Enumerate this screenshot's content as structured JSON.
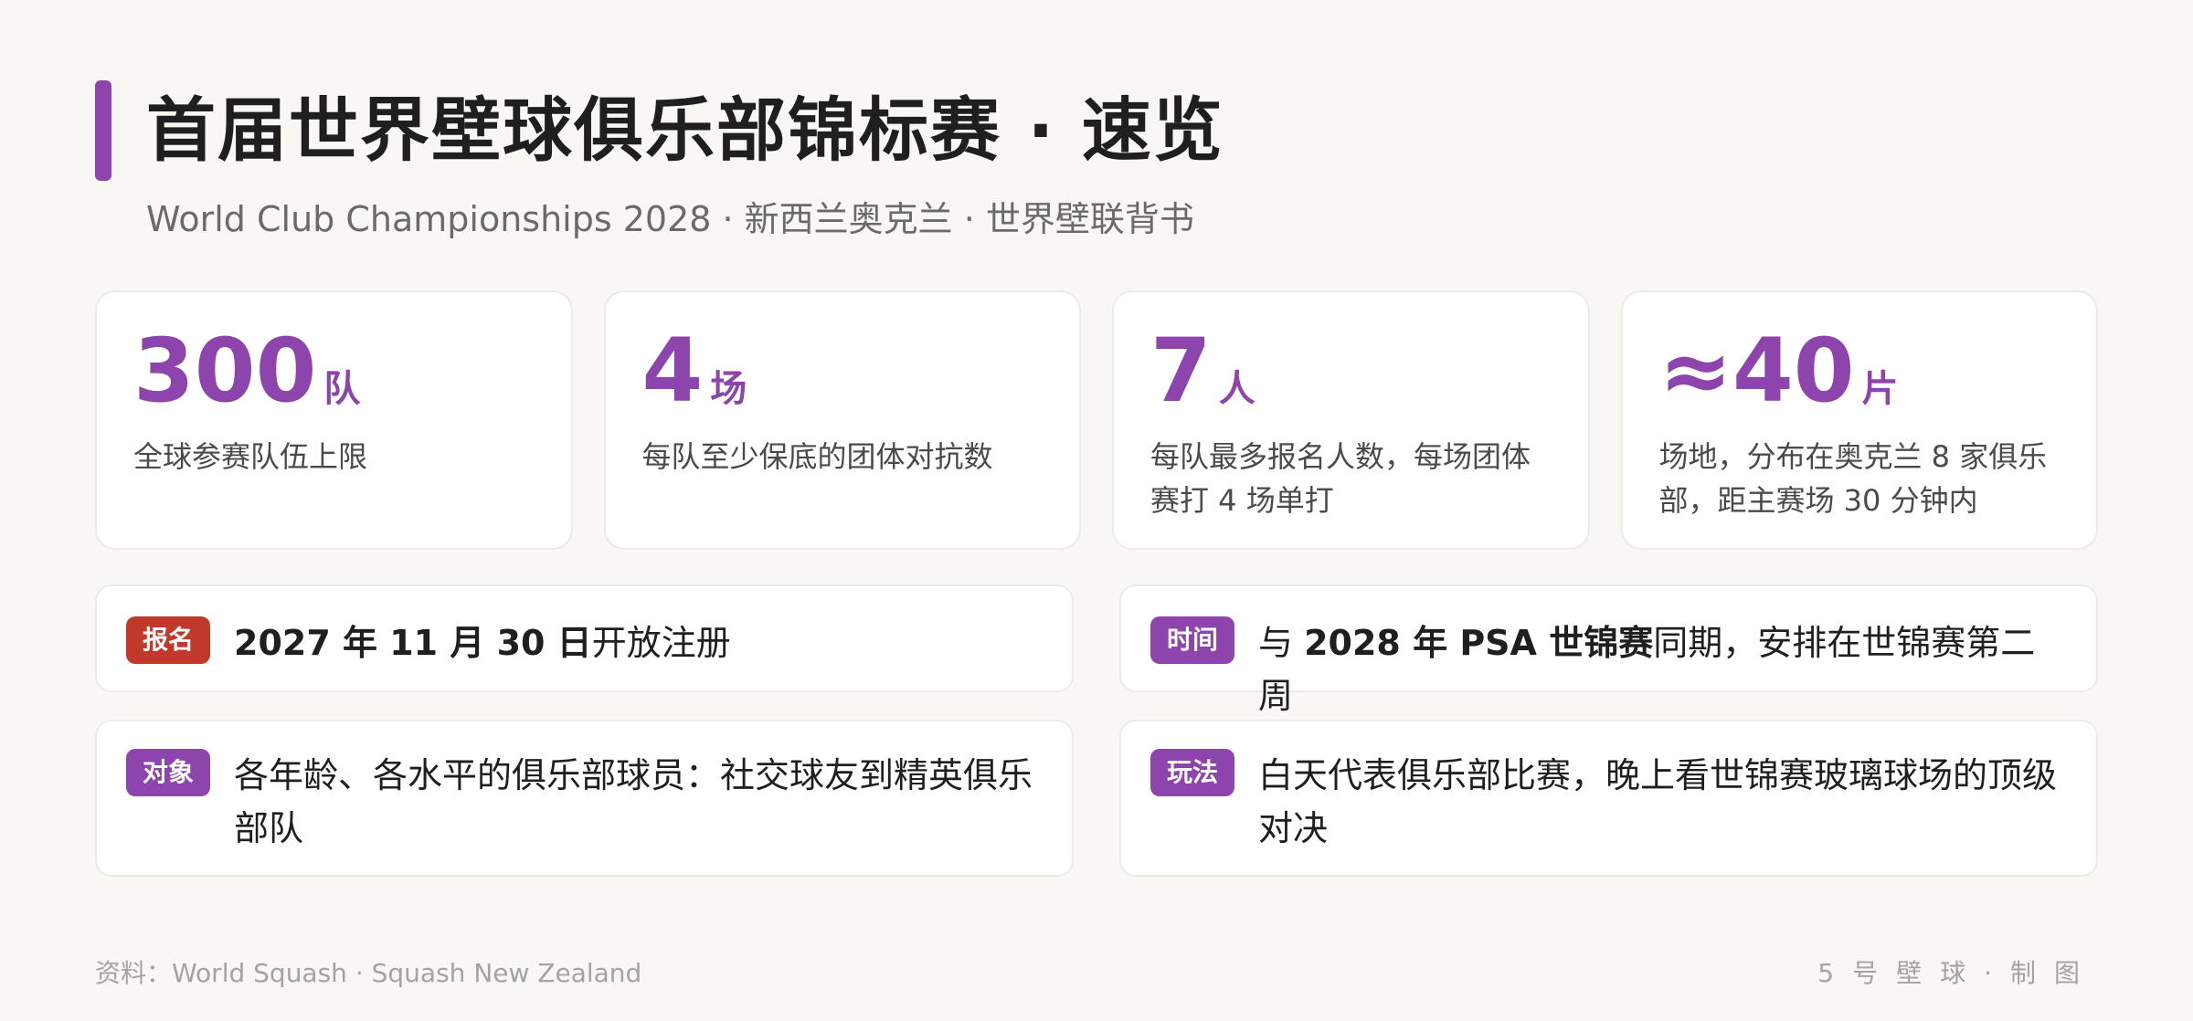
{
  "colors": {
    "accent": "#8e44ad",
    "tag_red": "#c0392b",
    "background": "#f8f7f4",
    "card": "#ffffff"
  },
  "header": {
    "title": "首届世界壁球俱乐部锦标赛 · 速览",
    "subtitle": "World Club Championships 2028 · 新西兰奥克兰 · 世界壁联背书"
  },
  "stats": [
    {
      "value": "300",
      "unit": "队",
      "desc": "全球参赛队伍上限"
    },
    {
      "value": "4",
      "unit": "场",
      "desc": "每队至少保底的团体对抗数"
    },
    {
      "value": "7",
      "unit": "人",
      "desc": "每队最多报名人数，每场团体赛打 4 场单打"
    },
    {
      "value": "≈40",
      "unit": "片",
      "desc": "场地，分布在奥克兰 8 家俱乐部，距主赛场 30 分钟内"
    }
  ],
  "info": {
    "registration": {
      "tag": "报名",
      "bold": "2027 年 11 月 30 日",
      "rest": "开放注册"
    },
    "timing": {
      "tag": "时间",
      "pre": "与 ",
      "bold": "2028 年 PSA 世锦赛",
      "rest": "同期，安排在世锦赛第二周"
    },
    "audience": {
      "tag": "对象",
      "text": "各年龄、各水平的俱乐部球员：社交球友到精英俱乐部队"
    },
    "format": {
      "tag": "玩法",
      "text": "白天代表俱乐部比赛，晚上看世锦赛玻璃球场的顶级对决"
    }
  },
  "footer": {
    "source": "资料：World Squash · Squash New Zealand",
    "credit": "5号壁球·制图"
  }
}
